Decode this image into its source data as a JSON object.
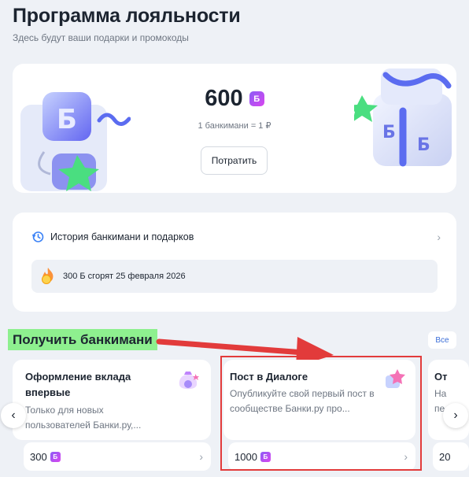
{
  "header": {
    "title": "Программа лояльности",
    "subtitle": "Здесь будут ваши подарки и промокоды"
  },
  "balance": {
    "amount": "600",
    "coin_symbol": "Б",
    "rate": "1 банкимани = 1 ₽",
    "spend_label": "Потратить"
  },
  "history": {
    "label": "История банкимани и подарков",
    "expire_text": "300 Б сгорят 25 февраля 2026"
  },
  "section": {
    "title": "Получить банкимани",
    "all_label": "Все"
  },
  "offers": [
    {
      "title_line1": "Оформление вклада",
      "title_line2": "впервые",
      "desc_line1": "Только для новых",
      "desc_line2": "пользователей Банки.ру,...",
      "reward": "300"
    },
    {
      "title_line1": "Пост в Диалоге",
      "desc_line1": "Опубликуйте свой первый пост в",
      "desc_line2": "сообществе Банки.ру про...",
      "reward": "1000"
    },
    {
      "title_line1": "От",
      "desc_line1": "На",
      "desc_line2": "пе",
      "reward": "20"
    }
  ],
  "navigation": {
    "prev": "‹",
    "next": "›"
  },
  "colors": {
    "background": "#eef1f6",
    "coin_gradient_start": "#8b5cf6",
    "coin_gradient_end": "#d946ef",
    "highlight_green": "#8ef08f",
    "annotation_red": "#e23b3b",
    "link_blue": "#3b6ed8"
  },
  "icons": [
    "history-clock-icon",
    "fire-coin-icon",
    "money-bag-icon",
    "star-icon",
    "chevron-right-icon",
    "arrow-left-icon",
    "arrow-right-icon"
  ]
}
